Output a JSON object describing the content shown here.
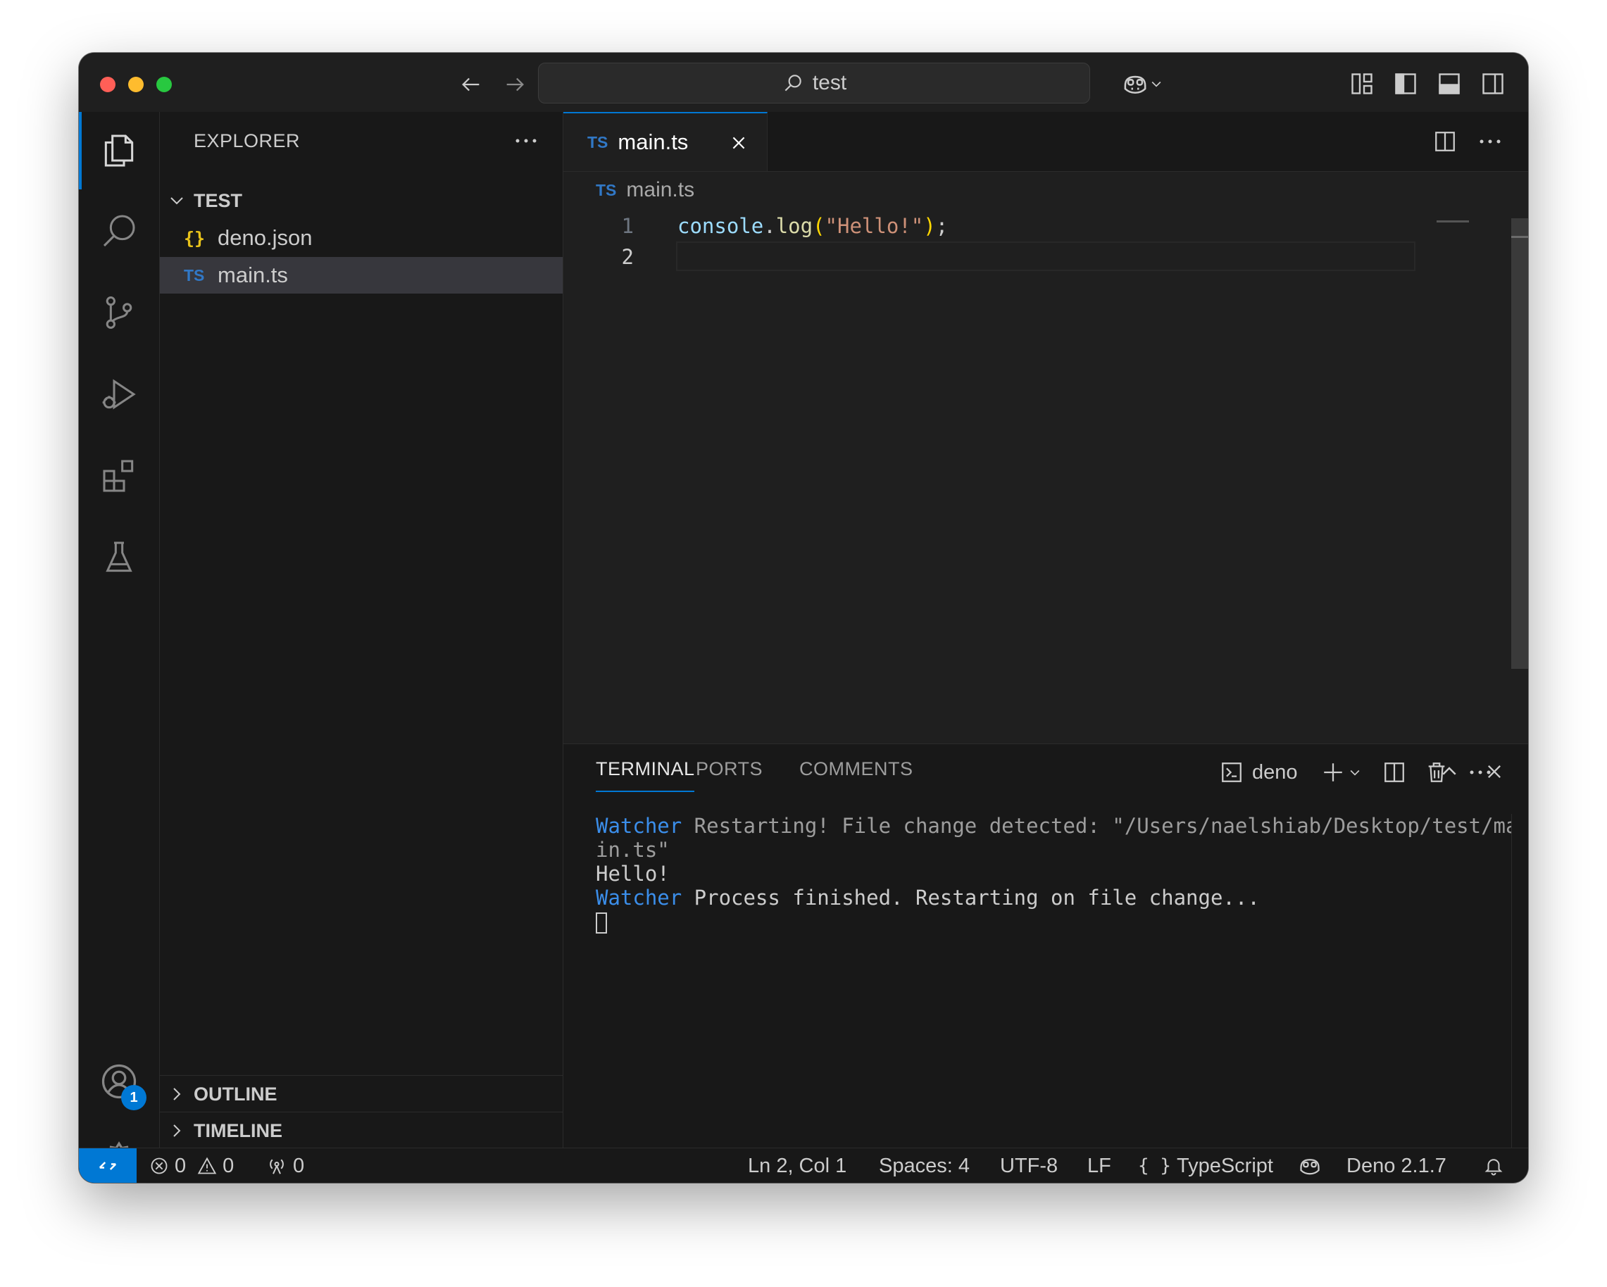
{
  "titlebar": {
    "search_text": "test"
  },
  "sidebar": {
    "title": "EXPLORER",
    "folder": "TEST",
    "files": [
      {
        "icon": "{}",
        "label": "deno.json"
      },
      {
        "icon": "TS",
        "label": "main.ts"
      }
    ],
    "outline_label": "OUTLINE",
    "timeline_label": "TIMELINE"
  },
  "accounts_badge": "1",
  "editor": {
    "tab_icon": "TS",
    "tab_label": "main.ts",
    "breadcrumb_icon": "TS",
    "breadcrumb_label": "main.ts",
    "line_numbers": [
      "1",
      "2"
    ],
    "code": {
      "ident": "console",
      "dot": ".",
      "fn": "log",
      "open": "(",
      "str": "\"Hello!\"",
      "close": ")",
      "semi": ";"
    }
  },
  "panel": {
    "tabs": [
      "TERMINAL",
      "PORTS",
      "COMMENTS"
    ],
    "terminal_name": "deno",
    "lines": {
      "l1_prefix": "Watcher",
      "l1_text": " Restarting! File change detected: \"/Users/naelshiab/Desktop/test/ma",
      "l2_text": "in.ts\"",
      "l3_text": "Hello!",
      "l4_prefix": "Watcher",
      "l4_text": " Process finished. Restarting on file change..."
    }
  },
  "statusbar": {
    "errors": "0",
    "warnings": "0",
    "ports": "0",
    "position": "Ln 2, Col 1",
    "spaces": "Spaces: 4",
    "encoding": "UTF-8",
    "eol": "LF",
    "language_icon": "{ }",
    "language": "TypeScript",
    "deno_version": "Deno 2.1.7"
  },
  "colors": {
    "accent": "#0078d4",
    "ts_badge": "#3178c6",
    "json_badge": "#e8c21a"
  }
}
